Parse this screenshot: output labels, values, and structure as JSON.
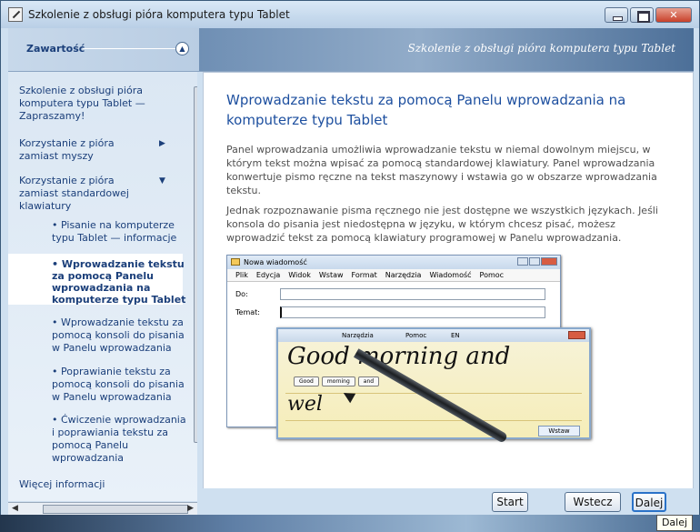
{
  "window": {
    "title": "Szkolenie z obsługi pióra komputera typu Tablet"
  },
  "header": {
    "contents_label": "Zawartość",
    "banner_text": "Szkolenie z obsługi pióra komputera typu Tablet"
  },
  "sidebar": {
    "items": [
      {
        "label": "Szkolenie z obsługi pióra komputera typu Tablet — Zapraszamy!"
      },
      {
        "label": "Korzystanie z pióra zamiast myszy",
        "arrow": "▶"
      },
      {
        "label": "Korzystanie z pióra zamiast standardowej klawiatury",
        "arrow": "▼"
      }
    ],
    "subitems": [
      {
        "label": "Pisanie na komputerze typu Tablet — informacje"
      },
      {
        "label": "Wprowadzanie tekstu za pomocą Panelu wprowadzania na komputerze typu Tablet"
      },
      {
        "label": "Wprowadzanie tekstu za pomocą konsoli do pisania w Panelu wprowadzania"
      },
      {
        "label": "Poprawianie tekstu za pomocą konsoli do pisania w Panelu wprowadzania"
      },
      {
        "label": "Ćwiczenie wprowadzania i poprawiania tekstu za pomocą Panelu wprowadzania"
      }
    ],
    "more": "Więcej informacji"
  },
  "content": {
    "title": "Wprowadzanie tekstu za pomocą Panelu wprowadzania na komputerze typu Tablet",
    "paragraph1": "Panel wprowadzania umożliwia wprowadzanie tekstu w niemal dowolnym miejscu, w którym tekst można wpisać za pomocą standardowej klawiatury. Panel wprowadzania konwertuje pismo ręczne na tekst maszynowy i wstawia go w obszarze wprowadzania tekstu.",
    "paragraph2": "Jednak rozpoznawanie pisma ręcznego nie jest dostępne we wszystkich językach. Jeśli konsola do pisania jest niedostępna w języku, w którym chcesz pisać, możesz wprowadzić tekst za pomocą klawiatury programowej w Panelu wprowadzania."
  },
  "illustration": {
    "mail_title": "Nowa wiadomość",
    "menu": [
      "Plik",
      "Edycja",
      "Widok",
      "Wstaw",
      "Format",
      "Narzędzia",
      "Wiadomość",
      "Pomoc"
    ],
    "to_label": "Do:",
    "subject_label": "Temat:",
    "tip_menu": [
      "Narzędzia",
      "Pomoc",
      "EN"
    ],
    "handwriting_line1": "Good morning and",
    "handwriting_line2": "wel",
    "suggestions": [
      "Good",
      "morning",
      "and"
    ],
    "insert_label": "Wstaw"
  },
  "buttons": {
    "start": "Start",
    "back": "Wstecz",
    "next": "Dalej"
  },
  "tooltip": "Dalej"
}
